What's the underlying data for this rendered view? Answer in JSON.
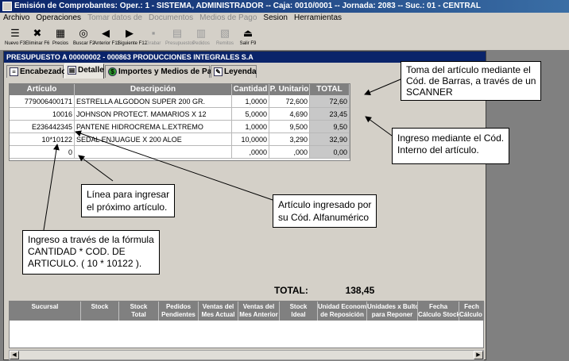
{
  "window": {
    "title": "Emisión de Comprobantes:  Oper.: 1 - SISTEMA, ADMINISTRADOR  --  Caja: 0010/0001  --  Jornada: 2083  --  Suc.: 01 - CENTRAL"
  },
  "menu": [
    {
      "label": "Archivo",
      "enabled": true
    },
    {
      "label": "Operaciones",
      "enabled": true
    },
    {
      "label": "Tomar datos de",
      "enabled": false
    },
    {
      "label": "Documentos",
      "enabled": false
    },
    {
      "label": "Medios de Pago",
      "enabled": false
    },
    {
      "label": "Sesion",
      "enabled": true
    },
    {
      "label": "Herramientas",
      "enabled": true
    }
  ],
  "toolbar": [
    {
      "label": "Nuevo F3",
      "icon": "new-doc-icon",
      "glyph": "☰",
      "enabled": true
    },
    {
      "label": "Eliminar F6",
      "icon": "delete-doc-icon",
      "glyph": "✖",
      "enabled": true
    },
    {
      "label": "Precios",
      "icon": "prices-icon",
      "glyph": "▦",
      "enabled": true
    },
    {
      "label": "Buscar F2",
      "icon": "binoculars-icon",
      "glyph": "◎",
      "enabled": true
    },
    {
      "label": "Anterior F11",
      "icon": "previous-arrow-icon",
      "glyph": "◀",
      "enabled": true
    },
    {
      "label": "Siguiente F12",
      "icon": "next-arrow-icon",
      "glyph": "▶",
      "enabled": true
    },
    {
      "label": "Grabar",
      "icon": "save-disk-icon",
      "glyph": "▪",
      "enabled": false
    },
    {
      "label": "Presupuestos",
      "icon": "budgets-icon",
      "glyph": "▤",
      "enabled": false
    },
    {
      "label": "Pedidos",
      "icon": "orders-icon",
      "glyph": "▥",
      "enabled": false
    },
    {
      "label": "Remitos",
      "icon": "delivery-icon",
      "glyph": "▧",
      "enabled": false
    },
    {
      "label": "Salir F9",
      "icon": "exit-door-icon",
      "glyph": "⏏",
      "enabled": true
    }
  ],
  "document": {
    "title": "PRESUPUESTO  A  00000002  -  000863  PRODUCCIONES INTEGRALES S.A",
    "tabs": [
      {
        "label": "Encabezado",
        "icon": "header-icon",
        "active": false
      },
      {
        "label": "Detalle",
        "icon": "detail-icon",
        "active": true
      },
      {
        "label": "Importes y Medios de Pago",
        "icon": "money-icon",
        "active": false
      },
      {
        "label": "Leyenda",
        "icon": "legend-icon",
        "active": false
      }
    ]
  },
  "grid": {
    "columns": [
      "Artículo",
      "Descripción",
      "Cantidad",
      "P. Unitario",
      "TOTAL"
    ],
    "rows": [
      [
        "779006400171",
        "ESTRELLA ALGODON SUPER 200 GR.",
        "1,0000",
        "72,600",
        "72,60"
      ],
      [
        "10016",
        "JOHNSON PROTECT. MAMARIOS X 12",
        "5,0000",
        "4,690",
        "23,45"
      ],
      [
        "E236442345",
        "PANTENE HIDROCREMA L.EXTREMO",
        "1,0000",
        "9,500",
        "9,50"
      ],
      [
        "10*10122",
        "SEDAL ENJUAGUE X 200 ALOE",
        "10,0000",
        "3,290",
        "32,90"
      ],
      [
        "0",
        "",
        ",0000",
        ",000",
        "0,00"
      ]
    ]
  },
  "totals": {
    "label": "TOTAL:",
    "value": "138,45"
  },
  "bottom_grid": {
    "columns": [
      [
        "Sucursal",
        ""
      ],
      [
        "Stock",
        ""
      ],
      [
        "Stock",
        "Total"
      ],
      [
        "Pedidos",
        "Pendientes"
      ],
      [
        "Ventas del",
        "Mes Actual"
      ],
      [
        "Ventas del",
        "Mes Anterior"
      ],
      [
        "Stock",
        "Ideal"
      ],
      [
        "Unidad Econom.",
        "de Reposición"
      ],
      [
        "Unidades x Bulto",
        "para Reponer"
      ],
      [
        "Fecha",
        "Cálculo Stock"
      ],
      [
        "Fech",
        "Cálculo V"
      ]
    ]
  },
  "callouts": {
    "scanner": [
      "Toma del artículo mediante el",
      "Cód. de Barras, a través de un",
      "SCANNER"
    ],
    "codigo_interno": [
      "Ingreso mediante el Cód.",
      "Interno del artículo."
    ],
    "proximo": [
      "Línea para ingresar",
      "el próximo artículo."
    ],
    "alfanumerico": [
      "Artículo ingresado por",
      "su Cód. Alfanumérico"
    ],
    "formula": [
      "Ingreso a través de la fórmula",
      "CANTIDAD * COD. DE",
      "ARTICULO. ( 10 * 10122 )."
    ]
  }
}
